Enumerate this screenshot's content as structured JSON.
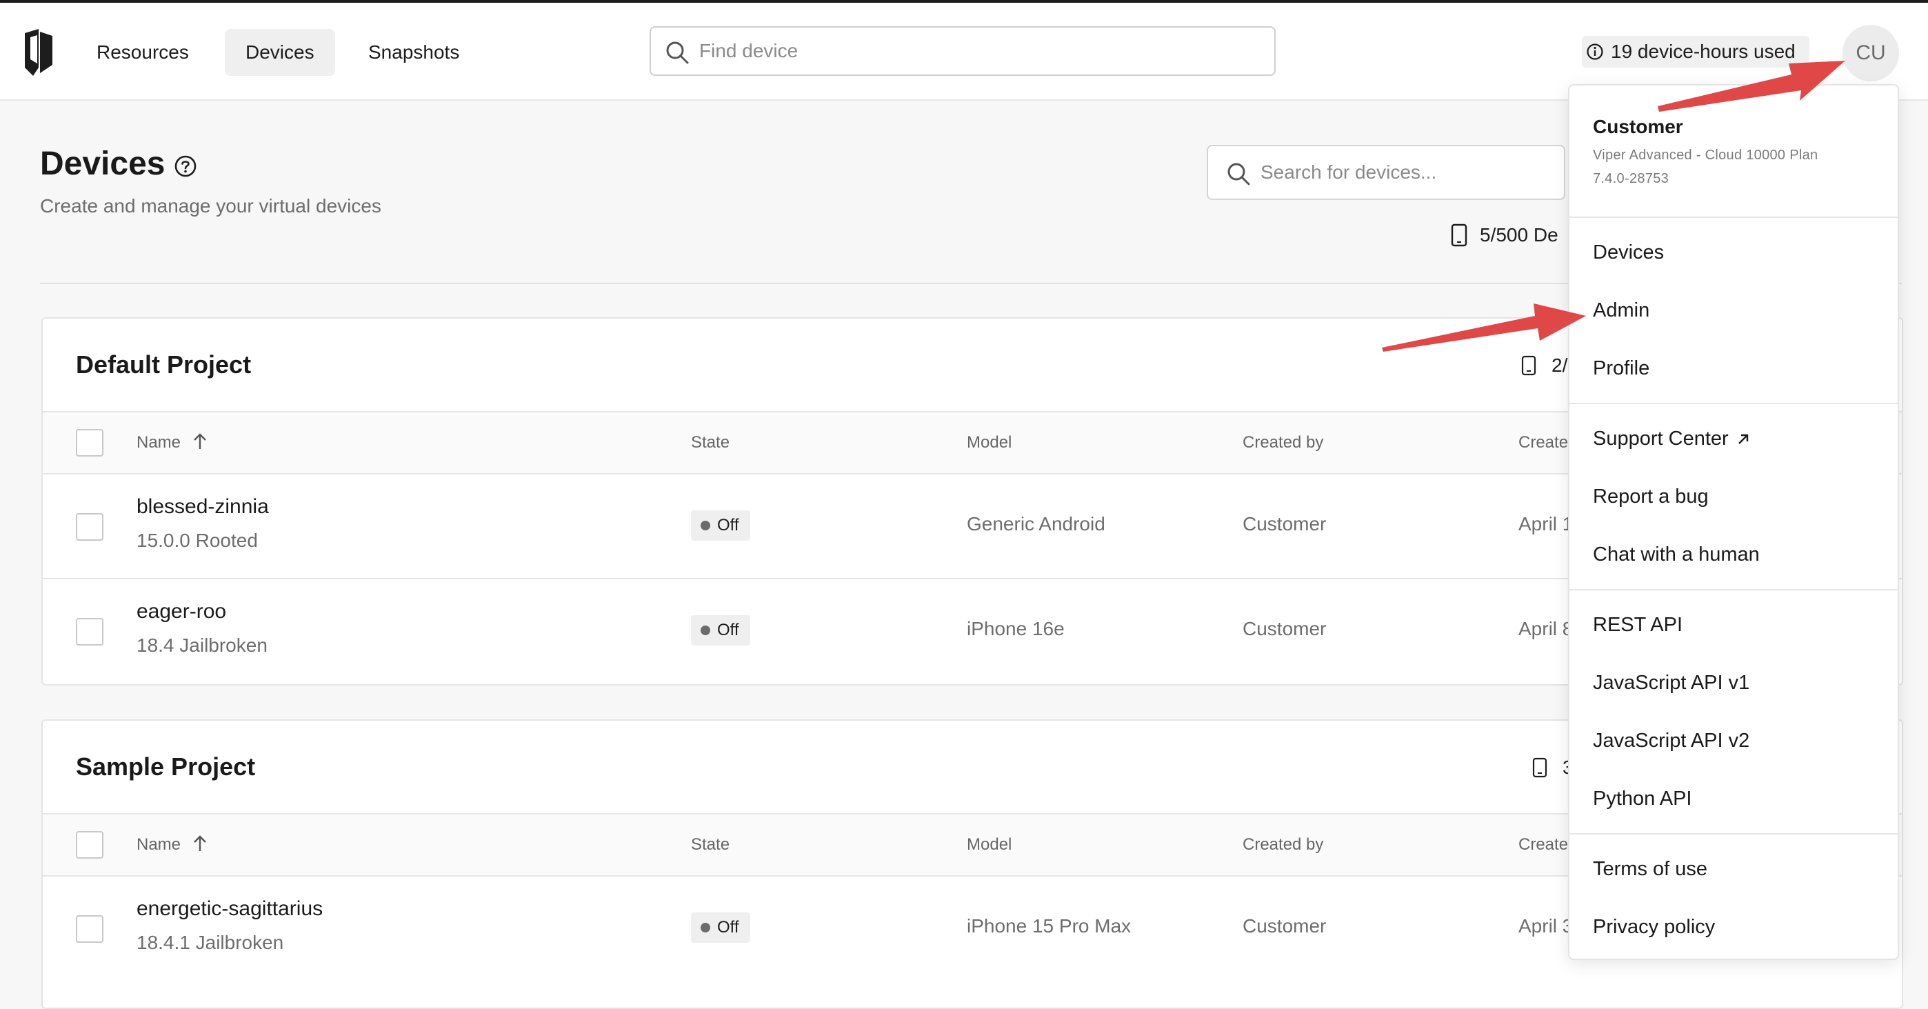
{
  "nav": {
    "links": [
      "Resources",
      "Devices",
      "Snapshots"
    ],
    "active": "Devices",
    "find_placeholder": "Find device",
    "usage_label": "19 device-hours used",
    "avatar_initials": "CU"
  },
  "page": {
    "title": "Devices",
    "subtitle": "Create and manage your virtual devices",
    "search_placeholder": "Search for devices...",
    "quota_visible": "5/500 De"
  },
  "table_headers": {
    "name": "Name",
    "state": "State",
    "model": "Model",
    "created_by": "Created by",
    "created_visible": "Create"
  },
  "projects": [
    {
      "title": "Default Project",
      "count_visible": "2/",
      "rows": [
        {
          "name": "blessed-zinnia",
          "sub": "15.0.0 Rooted",
          "state": "Off",
          "model": "Generic Android",
          "created_by": "Customer",
          "created_visible": "April 1"
        },
        {
          "name": "eager-roo",
          "sub": "18.4 Jailbroken",
          "state": "Off",
          "model": "iPhone 16e",
          "created_by": "Customer",
          "created_visible": "April 8"
        }
      ]
    },
    {
      "title": "Sample Project",
      "count_visible": "3",
      "rows": [
        {
          "name": "energetic-sagittarius",
          "sub": "18.4.1 Jailbroken",
          "state": "Off",
          "model": "iPhone 15 Pro Max",
          "created_by": "Customer",
          "created_visible": "April 3"
        }
      ]
    }
  ],
  "menu": {
    "user_name": "Customer",
    "plan": "Viper Advanced - Cloud 10000 Plan",
    "version": "7.4.0-28753",
    "items": [
      "Devices",
      "Admin",
      "Profile",
      "Support Center",
      "Report a bug",
      "Chat with a human",
      "REST API",
      "JavaScript API v1",
      "JavaScript API v2",
      "Python API",
      "Terms of use",
      "Privacy policy"
    ]
  },
  "icons": [
    "logo-icon",
    "search-icon",
    "info-icon",
    "help-icon",
    "device-icon",
    "sort-arrow-up-icon",
    "external-link-icon"
  ],
  "colors": {
    "annotation_arrow": "#e04848",
    "nav_active_bg": "#efefef"
  }
}
